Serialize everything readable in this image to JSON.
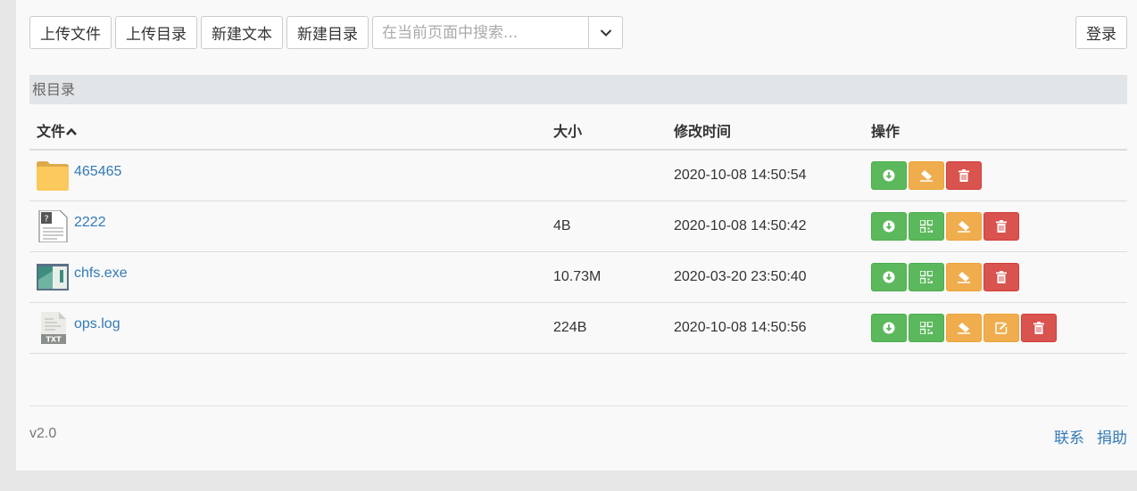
{
  "toolbar": {
    "upload_file": "上传文件",
    "upload_dir": "上传目录",
    "new_text": "新建文本",
    "new_dir": "新建目录",
    "search_placeholder": "在当前页面中搜索...",
    "login": "登录"
  },
  "breadcrumb": "根目录",
  "table": {
    "columns": [
      "文件",
      "大小",
      "修改时间",
      "操作"
    ],
    "sort_icon": "chevron-up-icon",
    "rows": [
      {
        "icon": "folder-icon",
        "name": "465465",
        "size": "",
        "mtime": "2020-10-08 14:50:54",
        "actions": [
          "download",
          "clear",
          "delete"
        ]
      },
      {
        "icon": "unknown-file-icon",
        "name": "2222",
        "size": "4B",
        "mtime": "2020-10-08 14:50:42",
        "actions": [
          "download",
          "qrcode",
          "clear",
          "delete"
        ]
      },
      {
        "icon": "exe-file-icon",
        "name": "chfs.exe",
        "size": "10.73M",
        "mtime": "2020-03-20 23:50:40",
        "actions": [
          "download",
          "qrcode",
          "clear",
          "delete"
        ]
      },
      {
        "icon": "txt-file-icon",
        "name": "ops.log",
        "size": "224B",
        "mtime": "2020-10-08 14:50:56",
        "actions": [
          "download",
          "qrcode",
          "clear",
          "edit",
          "delete"
        ]
      }
    ]
  },
  "footer": {
    "version": "v2.0",
    "contact": "联系",
    "donate": "捐助"
  },
  "colors": {
    "green": "#5cb85c",
    "orange": "#f0ad4e",
    "red": "#d9534f",
    "link": "#337ab7"
  }
}
